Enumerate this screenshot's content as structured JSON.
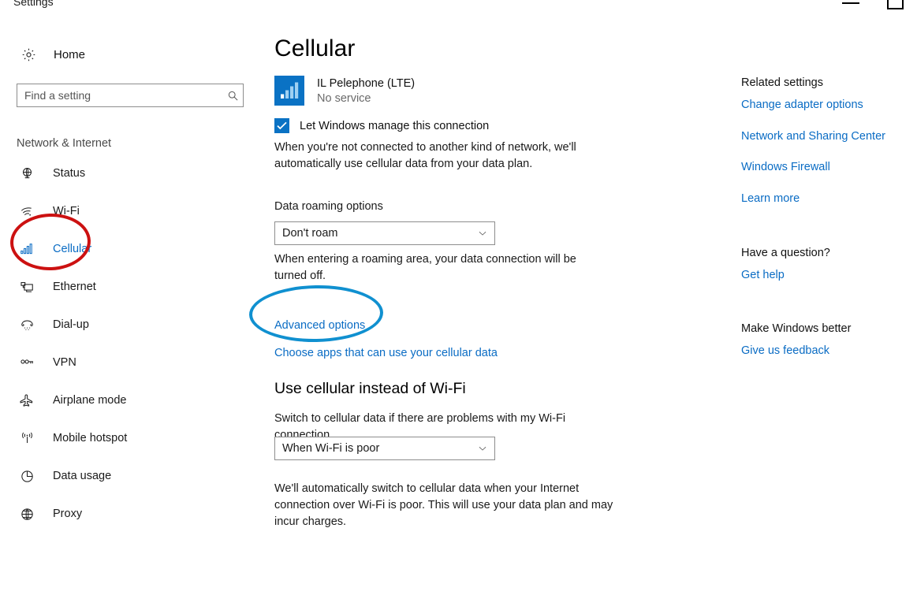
{
  "window": {
    "title": "Settings",
    "minimize_label": "Minimize",
    "maximize_label": "Maximize"
  },
  "sidebar": {
    "home_label": "Home",
    "home_icon": "gear-icon",
    "search": {
      "placeholder": "Find a setting",
      "value": "",
      "icon": "search-icon"
    },
    "section_heading": "Network & Internet",
    "items": [
      {
        "label": "Status",
        "icon": "status-globe-icon",
        "selected": false
      },
      {
        "label": "Wi-Fi",
        "icon": "wifi-icon",
        "selected": false
      },
      {
        "label": "Cellular",
        "icon": "cellular-bars-icon",
        "selected": true
      },
      {
        "label": "Ethernet",
        "icon": "ethernet-icon",
        "selected": false
      },
      {
        "label": "Dial-up",
        "icon": "dialup-phone-icon",
        "selected": false
      },
      {
        "label": "VPN",
        "icon": "vpn-key-icon",
        "selected": false
      },
      {
        "label": "Airplane mode",
        "icon": "airplane-icon",
        "selected": false
      },
      {
        "label": "Mobile hotspot",
        "icon": "hotspot-icon",
        "selected": false
      },
      {
        "label": "Data usage",
        "icon": "pie-chart-icon",
        "selected": false
      },
      {
        "label": "Proxy",
        "icon": "globe-icon",
        "selected": false
      }
    ]
  },
  "main": {
    "page_title": "Cellular",
    "carrier": {
      "name": "IL Pelephone (LTE)",
      "status": "No service",
      "icon": "signal-bars-icon"
    },
    "manage_checkbox": {
      "label": "Let Windows manage this connection",
      "checked": true
    },
    "manage_description": "When you're not connected to another kind of network, we'll automatically use cellular data from your data plan.",
    "roaming": {
      "label": "Data roaming options",
      "value": "Don't roam",
      "description": "When entering a roaming area, your data connection will be turned off."
    },
    "links": {
      "advanced_options": "Advanced options",
      "choose_apps": "Choose apps that can use your cellular data"
    },
    "wifi_section": {
      "heading": "Use cellular instead of Wi-Fi",
      "description": "Switch to cellular data if there are problems with my Wi-Fi connection",
      "value": "When Wi-Fi is poor",
      "note": "We'll automatically switch to cellular data when your Internet connection over Wi-Fi is poor. This will use your data plan and may incur charges."
    }
  },
  "right_panel": {
    "related_heading": "Related settings",
    "related_links": [
      "Change adapter options",
      "Network and Sharing Center",
      "Windows Firewall",
      "Learn more"
    ],
    "question_heading": "Have a question?",
    "question_link": "Get help",
    "better_heading": "Make Windows better",
    "better_link": "Give us feedback"
  },
  "annotations": {
    "red_ellipse": {
      "target": "Cellular",
      "color": "#cc1111"
    },
    "blue_ellipse": {
      "target": "Advanced options",
      "color": "#1090d0"
    }
  }
}
